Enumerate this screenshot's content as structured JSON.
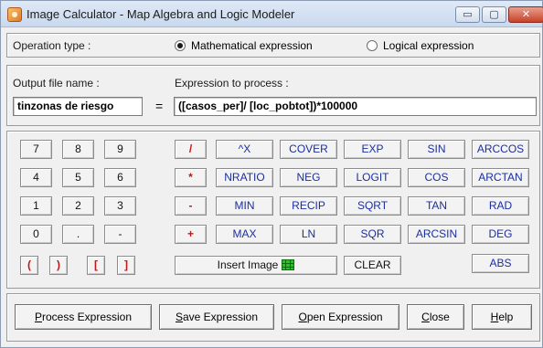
{
  "window": {
    "title": "Image Calculator - Map Algebra and Logic Modeler",
    "controls": {
      "minimize": "▭",
      "maximize": "▢",
      "close": "✕"
    }
  },
  "operation_type": {
    "label": "Operation type :",
    "options": [
      {
        "label": "Mathematical expression",
        "selected": true
      },
      {
        "label": "Logical expression",
        "selected": false
      }
    ]
  },
  "expression": {
    "output_label": "Output file name :",
    "output_value": "tinzonas de riesgo",
    "equals": "=",
    "expr_label": "Expression to process :",
    "expr_value": "([casos_per]/ [loc_pobtot])*100000"
  },
  "keypad": {
    "digits": [
      [
        "7",
        "8",
        "9"
      ],
      [
        "4",
        "5",
        "6"
      ],
      [
        "1",
        "2",
        "3"
      ],
      [
        "0",
        ".",
        "-"
      ]
    ],
    "brackets": [
      "(",
      ")",
      "[",
      "]"
    ],
    "operators": [
      "/",
      "*",
      "-",
      "+"
    ],
    "functions": [
      [
        "^X",
        "COVER",
        "EXP",
        "SIN",
        "ARCCOS"
      ],
      [
        "NRATIO",
        "NEG",
        "LOGIT",
        "COS",
        "ARCTAN"
      ],
      [
        "MIN",
        "RECIP",
        "SQRT",
        "TAN",
        "RAD"
      ],
      [
        "MAX",
        "LN",
        "SQR",
        "ARCSIN",
        "DEG"
      ]
    ],
    "insert_image": "Insert Image",
    "clear": "CLEAR",
    "abs": "ABS"
  },
  "actions": {
    "process": {
      "accel": "P",
      "rest": "rocess Expression"
    },
    "save": {
      "accel": "S",
      "rest": "ave Expression"
    },
    "open": {
      "accel": "O",
      "rest": "pen Expression"
    },
    "close": {
      "accel": "C",
      "rest": "lose"
    },
    "help": {
      "accel": "H",
      "rest": "elp"
    }
  },
  "colors": {
    "function_text": "#1a2fa0",
    "operator_text": "#c01818",
    "insert_image_icon": "#27c427"
  }
}
